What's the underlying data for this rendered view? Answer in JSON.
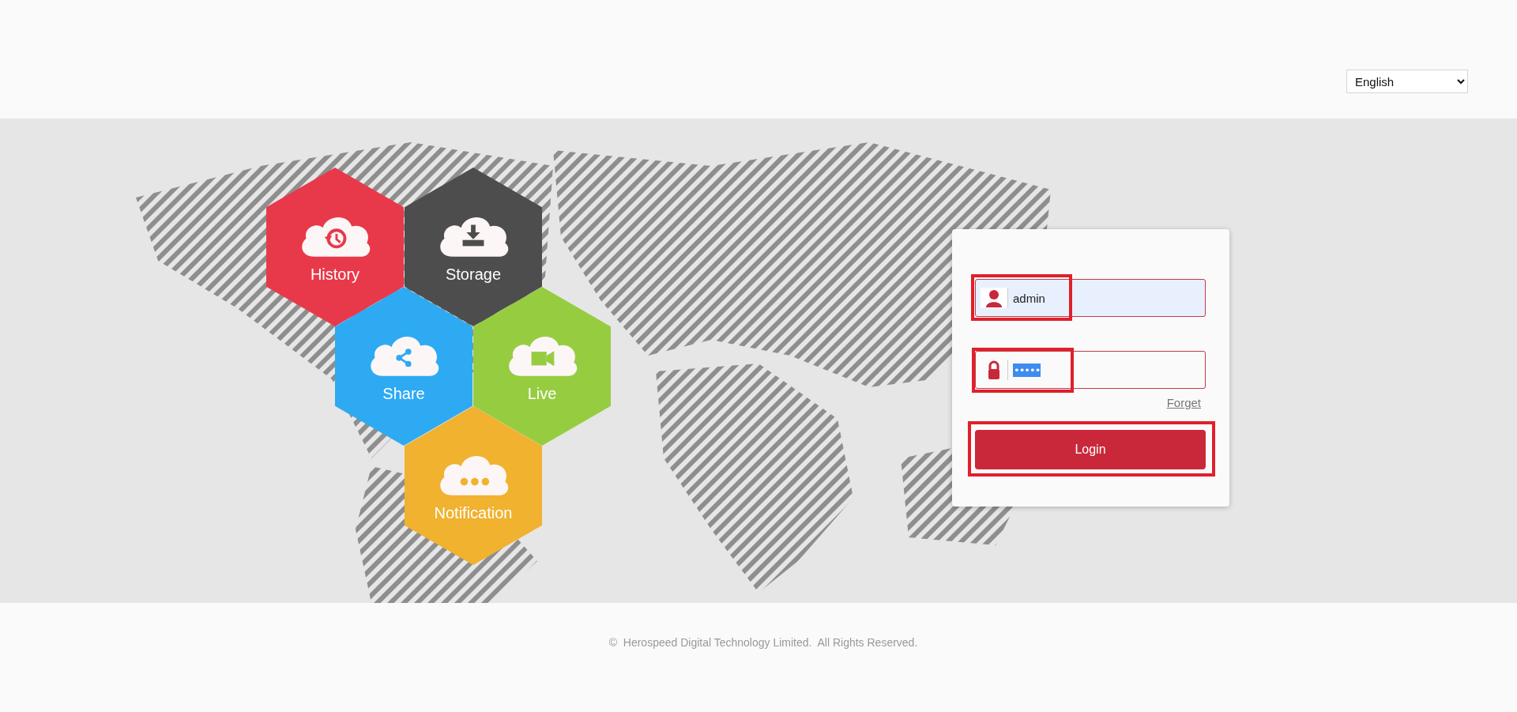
{
  "language": {
    "value": "English"
  },
  "tiles": [
    {
      "kind": "history",
      "label": "History",
      "color": "#e8394a"
    },
    {
      "kind": "storage",
      "label": "Storage",
      "color": "#4d4d4d"
    },
    {
      "kind": "share",
      "label": "Share",
      "color": "#2eaaf3"
    },
    {
      "kind": "live",
      "label": "Live",
      "color": "#96cd40"
    },
    {
      "kind": "notification",
      "label": "Notification",
      "color": "#f0b22f"
    }
  ],
  "login": {
    "username": {
      "value": "admin",
      "highlighted": true
    },
    "password": {
      "mask": "•••••",
      "highlighted": true
    },
    "forget_link": "Forget",
    "login_button": {
      "label": "Login",
      "highlighted": true
    }
  },
  "footer": {
    "copyright": "©  Herospeed Digital Technology Limited.  All Rights Reserved."
  }
}
